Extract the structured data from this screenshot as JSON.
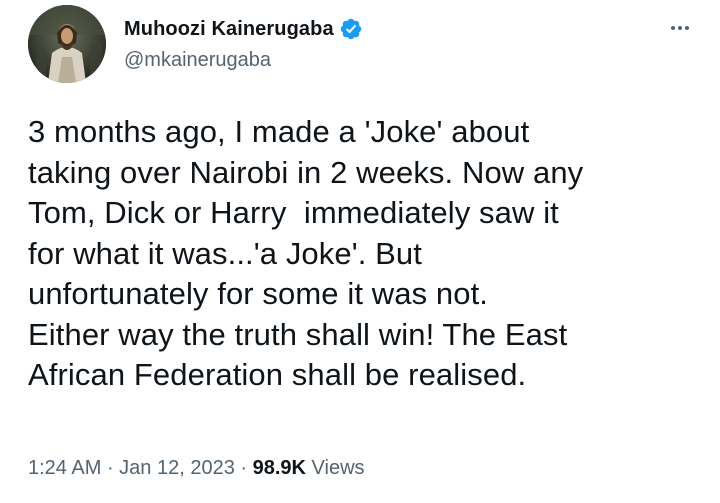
{
  "author": {
    "display_name": "Muhoozi Kainerugaba",
    "handle": "@mkainerugaba",
    "verified_icon": "verified-badge-icon",
    "avatar": "profile-avatar"
  },
  "tweet": {
    "text": "3 months ago, I made a 'Joke' about\ntaking over Nairobi in 2 weeks. Now any\nTom, Dick or Harry  immediately saw it\nfor what it was...'a Joke'. But\nunfortunately for some it was not.\nEither way the truth shall win! The East\nAfrican Federation shall be realised."
  },
  "meta": {
    "time": "1:24 AM",
    "separator": " · ",
    "date": "Jan 12, 2023",
    "views_count": "98.9K",
    "views_label": "Views"
  },
  "colors": {
    "text": "#0f1419",
    "secondary": "#536471",
    "verified": "#1d9bf0"
  },
  "icons": {
    "more": "more-horizontal-icon"
  }
}
